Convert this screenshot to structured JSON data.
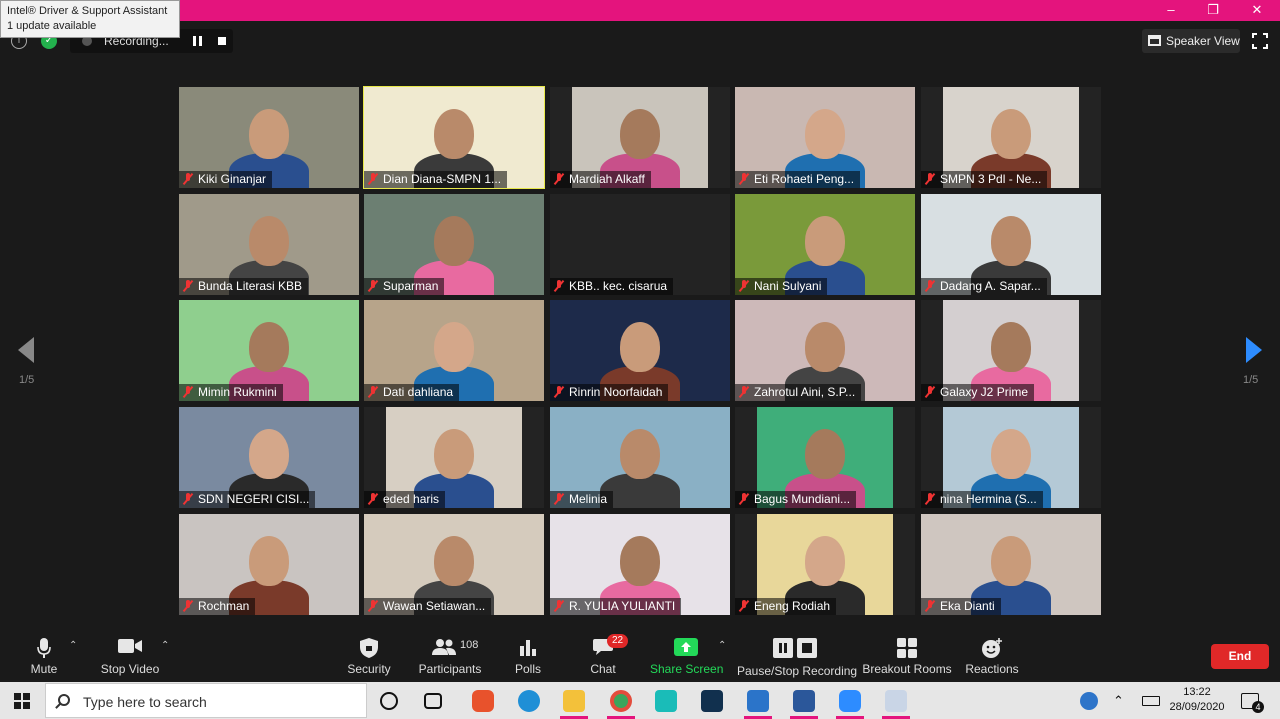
{
  "window": {
    "minimize": "–",
    "restore": "❐",
    "close": "✕"
  },
  "toast": {
    "title": "Intel® Driver & Support Assistant",
    "message": "1 update available"
  },
  "topbar": {
    "recording_label": "Recording...",
    "speaker_view_label": "Speaker View"
  },
  "participants": [
    {
      "name": "Kiki Ginanjar",
      "bg": "#8a8a7a",
      "active": false
    },
    {
      "name": "Dian Diana-SMPN 1...",
      "bg": "#f0ead0",
      "active": true
    },
    {
      "name": "Mardiah Alkaff",
      "bg": "#c9c4bb",
      "active": false
    },
    {
      "name": "Eti Rohaeti Peng...",
      "bg": "#c9b8b2",
      "active": false
    },
    {
      "name": "SMPN 3 Pdl - Ne...",
      "bg": "#d8d3cc",
      "active": false
    },
    {
      "name": "Bunda Literasi KBB",
      "bg": "#a09a8a",
      "active": false
    },
    {
      "name": "Suparman",
      "bg": "#6c7f72",
      "active": false
    },
    {
      "name": "KBB.. kec. cisarua",
      "bg": "#232323",
      "active": false
    },
    {
      "name": "Nani Sulyani",
      "bg": "#7a9a3a",
      "active": false
    },
    {
      "name": "Dadang A. Sapar...",
      "bg": "#d8dfe2",
      "active": false
    },
    {
      "name": "Mimin Rukmini",
      "bg": "#8fcf8e",
      "active": false
    },
    {
      "name": "Dati dahliana",
      "bg": "#b7a48a",
      "active": false
    },
    {
      "name": "Rinrin Noorfaidah",
      "bg": "#1d2a4a",
      "active": false
    },
    {
      "name": "Zahrotul Aini, S.P...",
      "bg": "#cdb9b9",
      "active": false
    },
    {
      "name": "Galaxy J2 Prime",
      "bg": "#d4cfd0",
      "active": false
    },
    {
      "name": "SDN NEGERI CISI...",
      "bg": "#7a8aa0",
      "active": false
    },
    {
      "name": "eded haris",
      "bg": "#d7cfc3",
      "active": false
    },
    {
      "name": "Melinia",
      "bg": "#8ab0c5",
      "active": false
    },
    {
      "name": "Bagus Mundiani...",
      "bg": "#3fae7a",
      "active": false
    },
    {
      "name": "nina Hermina (S...",
      "bg": "#b4c9d6",
      "active": false
    },
    {
      "name": "Rochman",
      "bg": "#c9c4c1",
      "active": false
    },
    {
      "name": "Wawan Setiawan...",
      "bg": "#d5cbbd",
      "active": false
    },
    {
      "name": "R. YULIA YULIANTI",
      "bg": "#e7e2e8",
      "active": false
    },
    {
      "name": "Eneng Rodiah",
      "bg": "#e8d79a",
      "active": false
    },
    {
      "name": "Eka Dianti",
      "bg": "#cfc6c0",
      "active": false
    }
  ],
  "pagination": {
    "left": "1/5",
    "right": "1/5"
  },
  "toolbar": {
    "mute": "Mute",
    "stop_video": "Stop Video",
    "security": "Security",
    "participants": "Participants",
    "participants_count": "108",
    "polls": "Polls",
    "chat": "Chat",
    "chat_badge": "22",
    "share_screen": "Share Screen",
    "pause_stop_recording": "Pause/Stop Recording",
    "breakout_rooms": "Breakout Rooms",
    "reactions": "Reactions",
    "end": "End"
  },
  "taskbar": {
    "search_placeholder": "Type here to search",
    "time": "13:22",
    "date": "28/09/2020",
    "notification_count": "4"
  },
  "colors": {
    "titlebar": "#e4147d",
    "share_screen": "#23d959",
    "end_button": "#e02828",
    "active_speaker_border": "#e8e94a"
  }
}
